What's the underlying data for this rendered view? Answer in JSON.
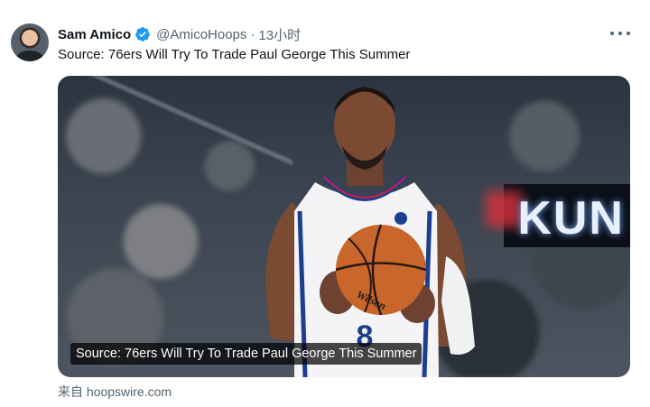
{
  "tweet": {
    "author_name": "Sam Amico",
    "handle": "@AmicoHoops",
    "separator": "·",
    "time": "13小时",
    "text": "Source: 76ers Will Try To Trade Paul George This Summer"
  },
  "media": {
    "caption": "Source: 76ers Will Try To Trade Paul George This Summer",
    "jersey_number": "8",
    "ball_brand": "Wilson",
    "scoreboard_text": "KUN"
  },
  "footer": {
    "source_prefix": "来自",
    "source_domain": "hoopswire.com"
  },
  "icons": {
    "verified": "verified-badge-icon",
    "more": "more-options-icon"
  },
  "colors": {
    "verified_blue": "#1d9bf0",
    "secondary_text": "#536471",
    "primary_text": "#0f1419"
  }
}
